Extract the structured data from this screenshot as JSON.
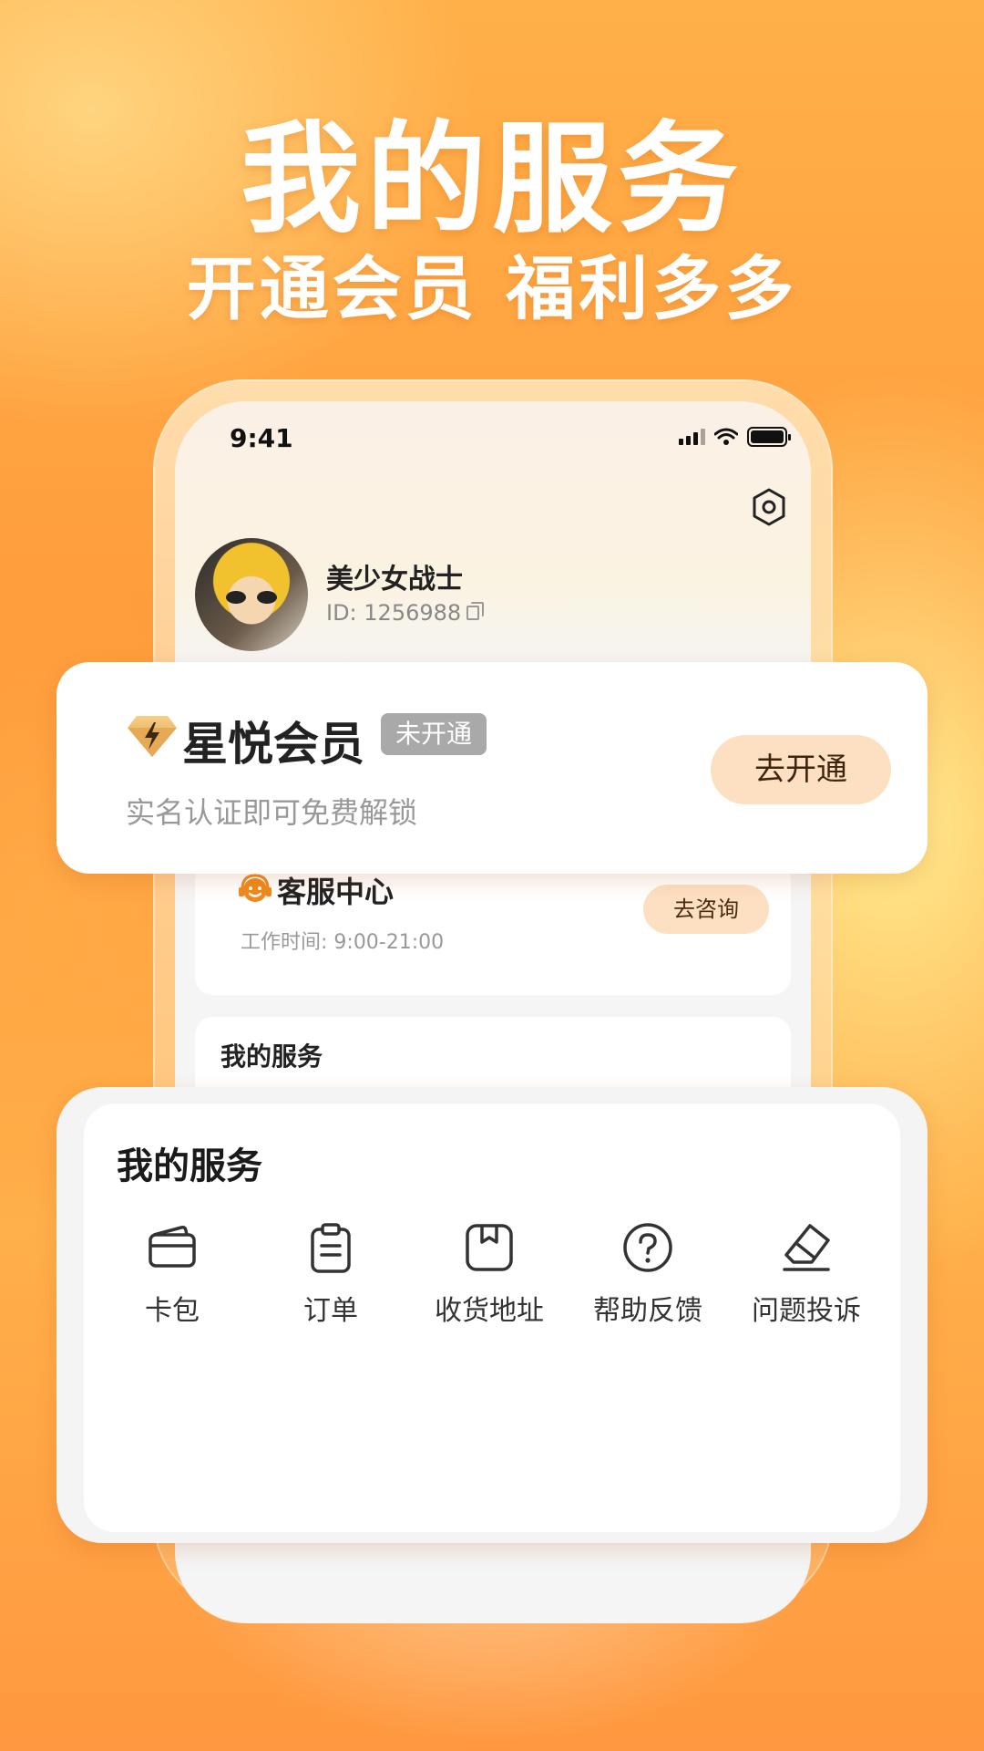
{
  "promo": {
    "headline": "我的服务",
    "subline": "开通会员 福利多多"
  },
  "status_bar": {
    "time": "9:41"
  },
  "profile": {
    "name": "美少女战士",
    "id_text": "ID: 1256988"
  },
  "membership": {
    "title": "星悦会员",
    "badge": "未开通",
    "description": "实名认证即可免费解锁",
    "button_label": "去开通"
  },
  "customer_service": {
    "title": "客服中心",
    "hours": "工作时间: 9:00-21:00",
    "button_label": "去咨询"
  },
  "services_preview": {
    "title": "我的服务"
  },
  "services": {
    "title": "我的服务",
    "items": [
      {
        "label": "卡包",
        "icon": "wallet-icon"
      },
      {
        "label": "订单",
        "icon": "clipboard-icon"
      },
      {
        "label": "收货地址",
        "icon": "package-icon"
      },
      {
        "label": "帮助反馈",
        "icon": "help-circle-icon"
      },
      {
        "label": "问题投诉",
        "icon": "eraser-icon"
      }
    ]
  },
  "colors": {
    "accent_orange": "#ff9a3a",
    "button_bg": "#fde0c2",
    "badge_gray": "#a9a9a9",
    "cs_icon": "#f08a1c"
  }
}
